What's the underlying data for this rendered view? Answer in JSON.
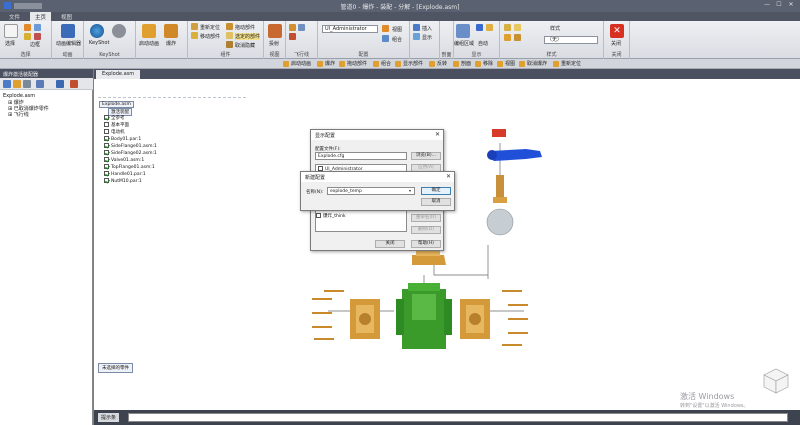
{
  "window": {
    "title": "管道0 - 爆炸 - 装配 - 分解 - [Explode.asm]",
    "min": "—",
    "max": "☐",
    "close": "✕"
  },
  "ribbon_tabs": [
    "文件",
    "主页",
    "视图"
  ],
  "ribbon": {
    "groups": [
      {
        "label": "选择",
        "buttons": [
          "选择",
          "边框"
        ]
      },
      {
        "label": "动画",
        "buttons": [
          "动画编辑器"
        ]
      },
      {
        "label": "KeyShot",
        "buttons": [
          "KeyShot"
        ]
      },
      {
        "label": "",
        "buttons": [
          "启动动画",
          "爆炸"
        ]
      },
      {
        "label": "组件",
        "buttons": [
          "重新定位",
          "移动部件",
          "拖动部件",
          "选定的部件",
          "取消隐藏"
        ]
      },
      {
        "label": "视图",
        "buttons": [
          "投射"
        ]
      },
      {
        "label": "飞行线",
        "buttons": [
          "视图"
        ]
      },
      {
        "label": "配置",
        "buttons": [
          "组合"
        ]
      },
      {
        "label": "",
        "buttons": [
          "插入",
          "显示"
        ]
      },
      {
        "label": "剖面",
        "buttons": []
      },
      {
        "label": "显示",
        "buttons": [
          "编组区域",
          "自动"
        ]
      },
      {
        "label": "样式",
        "buttons": [
          "样式"
        ]
      },
      {
        "label": "关闭",
        "buttons": [
          "关闭"
        ]
      }
    ],
    "configuration_value": "UI_Administrator",
    "style_value": "（无）",
    "style_label": "样式"
  },
  "toolbar2": [
    "启动动画",
    "爆炸",
    "拖动部件",
    "组合",
    "显示部件",
    "反转",
    "剖面",
    "移除",
    "视图",
    "取消爆炸",
    "重新定位"
  ],
  "left_pane": {
    "header": "爆炸激活装配器",
    "tree": [
      "Explode.asm",
      "爆炸",
      "已取消爆炸零件",
      "飞行线"
    ]
  },
  "doc_tab": "Explode.asm",
  "assembly_tree": {
    "root": "Explode.asm",
    "items": [
      "激活装配",
      "全参考",
      "基本平面",
      "电动机",
      "Body01.par:1",
      "SideFlange01.asm:1",
      "SideFlange02.asm:1",
      "Valve01.asm:1",
      "TopFlange01.asm:1",
      "Handle01.par:1",
      "NutM10.par:1"
    ]
  },
  "bottom_button": "未选择的零件",
  "config_dialog": {
    "title": "显示配置",
    "file_label": "配置文件(F):",
    "file_value": "Explode.cfg",
    "browse": "浏览(B)...",
    "list": [
      "UI_Administrator",
      "爆炸_think"
    ],
    "apply": "应用(A)",
    "save": "保存(S)",
    "rename": "重命名(R)",
    "delete": "删除(D)",
    "close": "关闭",
    "help": "帮助(H)"
  },
  "new_config_dialog": {
    "title": "新建配置",
    "name_label": "名称(N):",
    "name_value": "explode_temp",
    "ok": "确定",
    "cancel": "取消"
  },
  "command_bar": {
    "label": "提示条"
  },
  "watermark": {
    "line1": "激活 Windows",
    "line2": "转到\"设置\"以激活 Windows。"
  },
  "colors": {
    "bronze": "#d49a3a",
    "green": "#3a9a2a",
    "blue": "#1f4fd0",
    "red": "#d03020",
    "silver": "#c8d0d8"
  }
}
